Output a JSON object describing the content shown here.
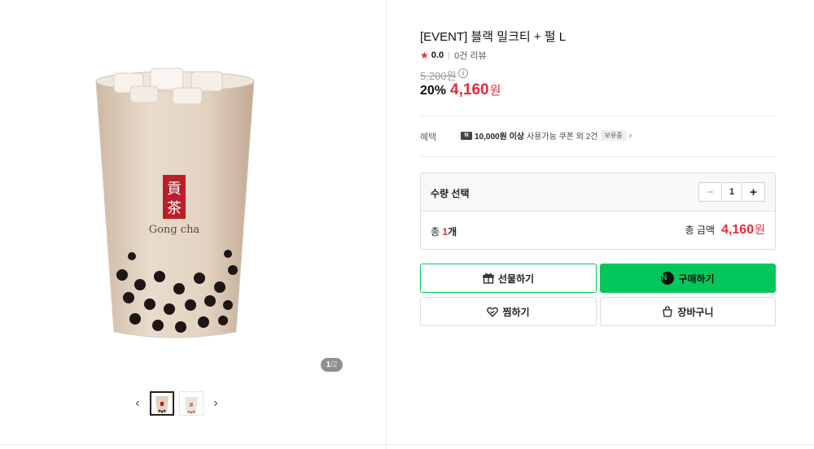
{
  "gallery": {
    "image_alt": "Gong cha black milk tea with pearls",
    "brand_text": "Gong cha",
    "pager_current": "1",
    "pager_separator": "/",
    "pager_total": "2",
    "prev_icon": "chevron-left-icon",
    "next_icon": "chevron-right-icon"
  },
  "product": {
    "title": "[EVENT] 블랙 밀크티 + 펄 L",
    "rating_score": "0.0",
    "review_count": "0건 리뷰",
    "original_price": "5,200원",
    "discount_rate": "20%",
    "sale_price": "4,160",
    "currency": "원"
  },
  "benefit": {
    "label": "혜택",
    "badge": "N",
    "amount": "10,000원 이상",
    "text": "사용가능 쿠폰 외 2건",
    "tag": "보유중"
  },
  "quantity": {
    "label": "수량 선택",
    "value": "1",
    "total_prefix": "총",
    "total_count": "1",
    "total_unit": "개",
    "total_amount_label": "총 금액",
    "total_amount": "4,160",
    "total_currency": "원"
  },
  "buttons": {
    "gift": "선물하기",
    "buy": "구매하기",
    "wish": "찜하기",
    "cart": "장바구니"
  },
  "colors": {
    "accent_red": "#e8293c",
    "naver_green": "#03c75a"
  }
}
